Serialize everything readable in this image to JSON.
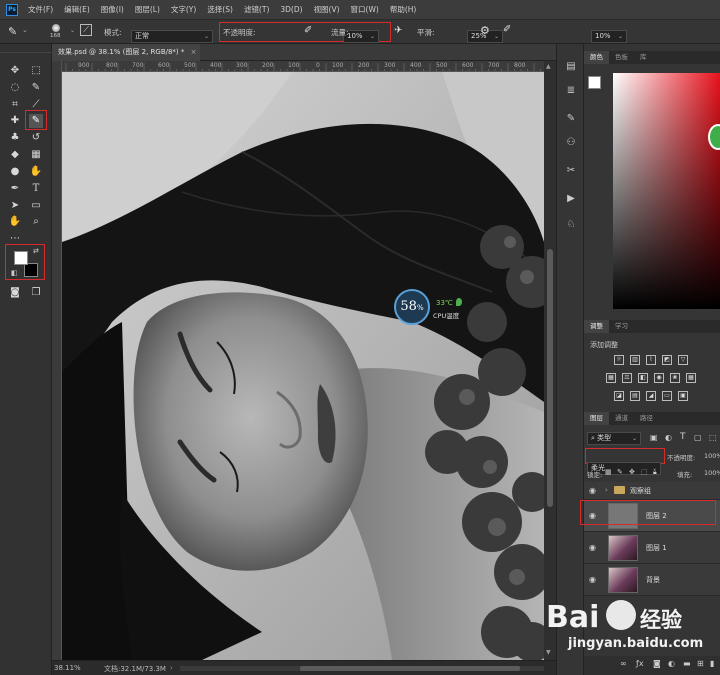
{
  "app": {
    "logo": "Ps"
  },
  "menu": [
    "文件(F)",
    "编辑(E)",
    "图像(I)",
    "图层(L)",
    "文字(Y)",
    "选择(S)",
    "滤镜(T)",
    "3D(D)",
    "视图(V)",
    "窗口(W)",
    "帮助(H)"
  ],
  "options": {
    "brush_size": "168",
    "mode_label": "模式:",
    "mode_value": "正常",
    "opacity_label": "不透明度:",
    "opacity_value": "10%",
    "flow_label": "流量:",
    "flow_value": "25%",
    "smooth_label": "平滑:",
    "smooth_value": "10%"
  },
  "document": {
    "tab_title": "效果.psd @ 38.1% (图层 2, RGB/8*) *",
    "close": "×",
    "ruler_labels": [
      "900",
      "800",
      "700",
      "600",
      "500",
      "400",
      "300",
      "200",
      "100",
      "0",
      "100",
      "200",
      "300",
      "400",
      "500",
      "600",
      "700",
      "800",
      "900"
    ]
  },
  "status": {
    "zoom": "38.11%",
    "doc": "文档:32.1M/73.3M"
  },
  "cpu_widget": {
    "value": "58",
    "unit": "%",
    "temp": "33℃",
    "label": "CPU温度"
  },
  "color_panel": {
    "tabs": [
      "颜色",
      "色板",
      "库"
    ]
  },
  "adjust_panel": {
    "tabs": [
      "调整",
      "学习"
    ],
    "title": "添加调整"
  },
  "layers_panel": {
    "tabs": [
      "图层",
      "通道",
      "路径"
    ],
    "filter": "类型",
    "blend_mode": "柔光",
    "opacity_label": "不透明度:",
    "opacity_value": "100%",
    "lock_label": "锁定:",
    "fill_label": "填充:",
    "fill_value": "100%",
    "layers": [
      {
        "name": "观察组"
      },
      {
        "name": "图层 2"
      },
      {
        "name": "图层 1"
      },
      {
        "name": "背景"
      }
    ]
  },
  "watermark": {
    "brand": "Bai",
    "brand2": "经验",
    "url": "jingyan.baidu.com"
  },
  "colors": {
    "accent_red": "#d62b2b",
    "panel_bg": "#353535",
    "highlight": "#31a8ff"
  }
}
